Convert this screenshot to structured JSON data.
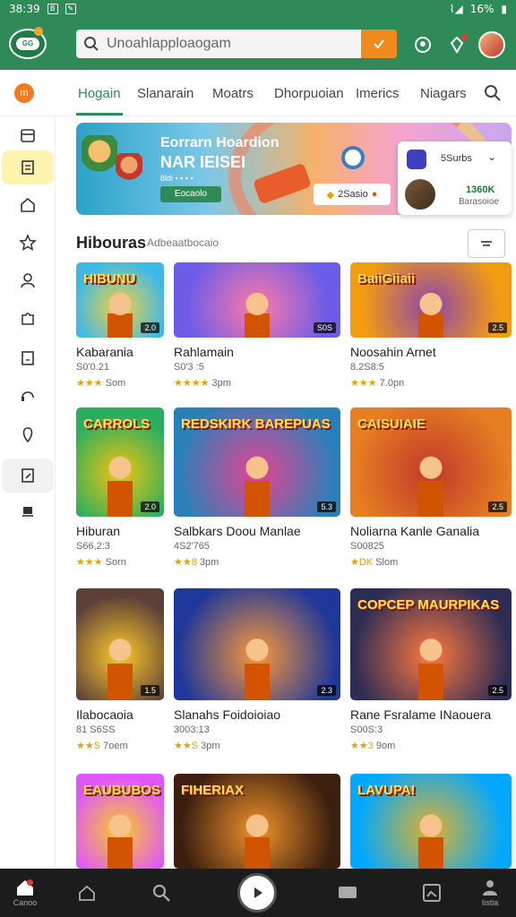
{
  "status": {
    "time": "38:39",
    "battery": "16%"
  },
  "header": {
    "search_placeholder": "Unoahlapploaogam"
  },
  "tabs": [
    {
      "label": "Hogain",
      "active": true
    },
    {
      "label": "Slanarain"
    },
    {
      "label": "Moatrs"
    },
    {
      "label": "Dhorpuoian"
    },
    {
      "label": "Imerics"
    },
    {
      "label": "Niagars"
    }
  ],
  "banner": {
    "title1": "Eorrarn Hoardion",
    "title2": "NAR IEISEI",
    "sub": "8ldi ▪ ▪ ▪ ▪",
    "button": "Eocaolo",
    "pill": "2Sasio"
  },
  "popup": {
    "label": "5Surbs",
    "number": "1360K",
    "sub": "Barasoioe"
  },
  "section": {
    "title": "Hibouras",
    "subtitle": "Adbeaatbocaio"
  },
  "games": [
    {
      "title": "Kabarania",
      "meta": "S0'0.21",
      "stars": "★★★",
      "rating": "Som",
      "badge": "2.0",
      "art": "HIBUNU"
    },
    {
      "title": "Rahlamain",
      "meta": "S0'3 :5",
      "stars": "★★★★",
      "rating": "3pm",
      "badge": "S0S",
      "art": ""
    },
    {
      "title": "Noosahin Arnet",
      "meta": "8.2S8:5",
      "stars": "★★★",
      "rating": "7.0pn",
      "badge": "2.5",
      "art": "BaiiGiiaii"
    },
    {
      "title": "Hiburan",
      "meta": "S66,2:3",
      "stars": "★★★",
      "rating": "Sorn",
      "badge": "2.0",
      "art": "CARROLS"
    },
    {
      "title": "Salbkars Doou Manlae",
      "meta": "4S2'765",
      "stars": "★★8",
      "rating": "3pm",
      "badge": "5.3",
      "art": "REDSKIRK BAREPUAS"
    },
    {
      "title": "Noliarna Kanle Ganalia",
      "meta": "S00825",
      "stars": "★DK",
      "rating": "Slom",
      "badge": "2.5",
      "art": "CAISUIAIE"
    },
    {
      "title": "Ilabocaoia",
      "meta": "81 S6SS",
      "stars": "★★S",
      "rating": "7oem",
      "badge": "1.5",
      "art": ""
    },
    {
      "title": "Slanahs Foidoioiao",
      "meta": "3003:13",
      "stars": "★★S",
      "rating": "3pm",
      "badge": "2.3",
      "art": ""
    },
    {
      "title": "Rane Fsralame INaouera",
      "meta": "S00S:3",
      "stars": "★★3",
      "rating": "9om",
      "badge": "2.5",
      "art": "COPCEP MAURPIKAS"
    },
    {
      "title": "",
      "meta": "",
      "stars": "",
      "rating": "",
      "badge": "",
      "art": "EAUBUBOS"
    },
    {
      "title": "",
      "meta": "",
      "stars": "",
      "rating": "",
      "badge": "",
      "art": "FIHERIAX"
    },
    {
      "title": "",
      "meta": "",
      "stars": "",
      "rating": "",
      "badge": "",
      "art": "LAVUPA!"
    }
  ],
  "nav": [
    {
      "label": "Canoo",
      "icon": "home-icon"
    },
    {
      "label": "",
      "icon": "house-outline-icon"
    },
    {
      "label": "",
      "icon": "search-icon"
    },
    {
      "label": "",
      "icon": "play-icon"
    },
    {
      "label": "",
      "icon": "chat-icon"
    },
    {
      "label": "",
      "icon": "gallery-icon"
    },
    {
      "label": "Iistia",
      "icon": "profile-icon"
    }
  ],
  "colors": {
    "brand": "#2e8b57",
    "accent": "#f08a1c",
    "nav": "#1c1c1c"
  }
}
